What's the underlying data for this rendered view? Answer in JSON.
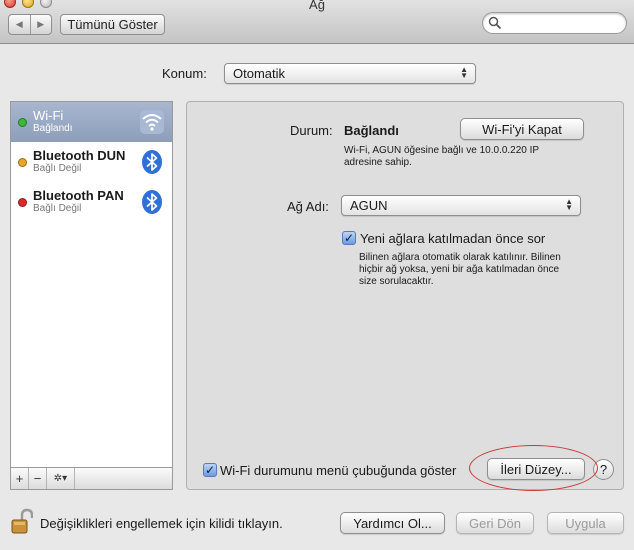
{
  "window": {
    "title": "Ağ"
  },
  "toolbar": {
    "back": "◀",
    "forward": "▶",
    "show_all": "Tümünü Göster"
  },
  "location": {
    "label": "Konum:",
    "value": "Otomatik"
  },
  "services": [
    {
      "name": "Wi-Fi",
      "state": "Bağlandı",
      "dot_color": "#3db83a",
      "icon": "wifi-icon"
    },
    {
      "name": "Bluetooth DUN",
      "state": "Bağlı Değil",
      "dot_color": "#e9a72a",
      "icon": "bluetooth-icon"
    },
    {
      "name": "Bluetooth PAN",
      "state": "Bağlı Değil",
      "dot_color": "#d92b2b",
      "icon": "bluetooth-icon"
    }
  ],
  "sidebar_tools": {
    "add": "+",
    "remove": "−",
    "gear": "✲▾"
  },
  "status": {
    "label": "Durum:",
    "value": "Bağlandı",
    "button": "Wi-Fi'yi Kapat",
    "desc_line1": "Wi-Fi, AGUN öğesine bağlı ve 10.0.0.220 IP",
    "desc_line2": "adresine sahip."
  },
  "network": {
    "label": "Ağ Adı:",
    "value": "AGUN",
    "ask_label": "Yeni ağlara katılmadan önce sor",
    "ask_checked": true,
    "ask_desc_line1": "Bilinen ağlara otomatik olarak katılınır. Bilinen",
    "ask_desc_line2": "hiçbir ağ yoksa, yeni bir ağa katılmadan önce",
    "ask_desc_line3": "size sorulacaktır."
  },
  "menubar_option": {
    "label": "Wi-Fi durumunu menü çubuğunda göster",
    "checked": true
  },
  "advanced_button": "İleri Düzey...",
  "help": "?",
  "footer": {
    "lock_text": "Değişiklikleri engellemek için kilidi tıklayın.",
    "assist": "Yardımcı Ol...",
    "revert": "Geri Dön",
    "apply": "Uygula"
  },
  "colors": {
    "annotation": "#c73a3a",
    "selection": "#95a6c1",
    "bluetooth": "#2f6fd8"
  }
}
